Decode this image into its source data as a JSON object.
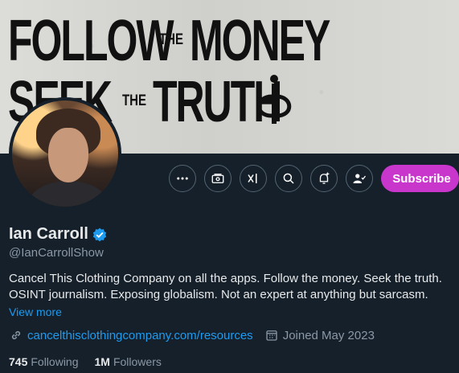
{
  "banner": {
    "line1_a": "FOLLOW",
    "line1_the": "THE",
    "line1_b": "MONEY",
    "line2_a": "SEEK",
    "line2_the": "THE",
    "line2_b": "TRUTH"
  },
  "actions": {
    "more_icon": "more-horizontal-icon",
    "subscribe_label": "Subscribe"
  },
  "profile": {
    "name": "Ian Carroll",
    "handle": "@IanCarrollShow",
    "bio_lines": [
      "Cancel This Clothing Company on all the apps. Follow the money. Seek the truth.",
      "OSINT journalism. Exposing globalism. Not an expert at anything but sarcasm."
    ],
    "view_more": "View more",
    "link": "cancelthisclothingcompany.com/resources",
    "joined": "Joined May 2023",
    "following_count": "745",
    "following_label": "Following",
    "followers_count": "1M",
    "followers_label": "Followers"
  },
  "colors": {
    "background": "#15202b",
    "accent": "#1d9bf0",
    "subscribe": "#c936cc",
    "text_primary": "#e7e9ea",
    "text_secondary": "#8b98a5"
  }
}
